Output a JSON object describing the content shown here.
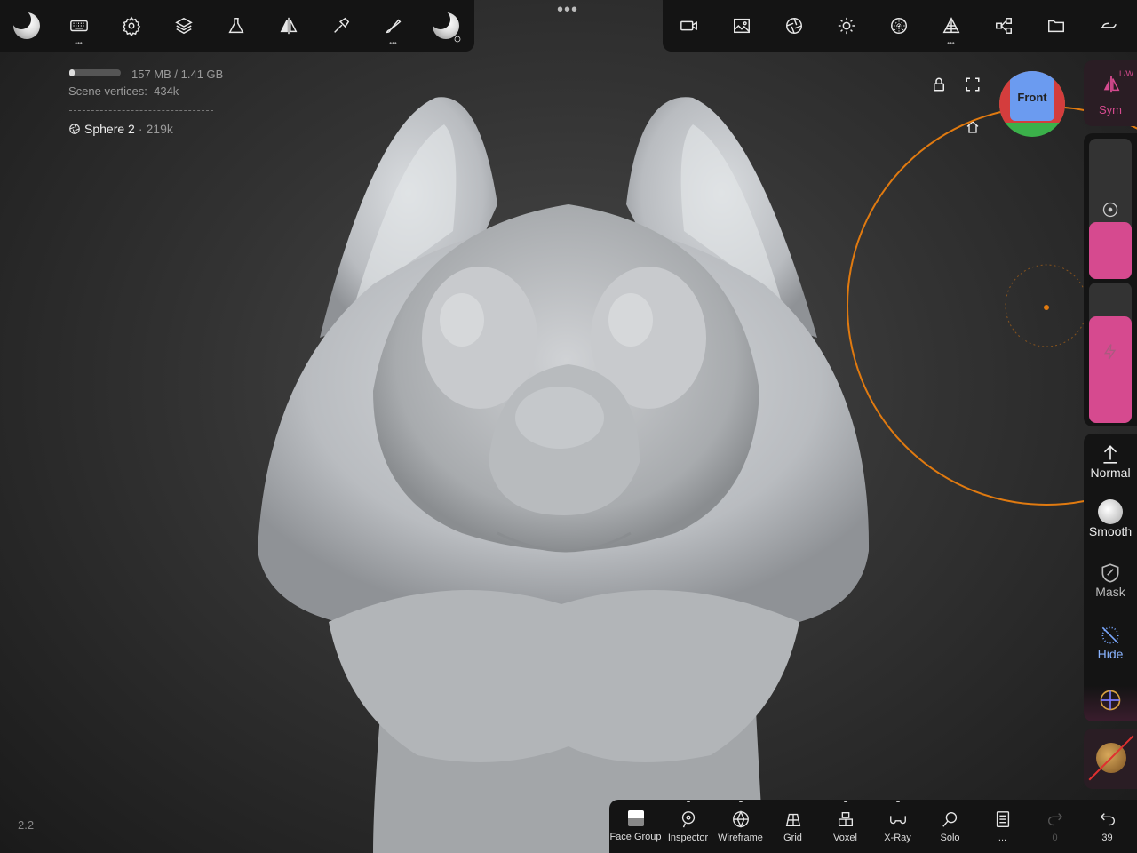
{
  "top_toolbar": {
    "left_tools": [
      "nomad-logo",
      "keyboard",
      "settings",
      "layers",
      "material",
      "symmetry",
      "brush",
      "paint",
      "stroke-settings"
    ],
    "right_tools": [
      "camera",
      "background",
      "shading",
      "lights",
      "matcap",
      "topology",
      "scene",
      "files",
      "quick-menu"
    ]
  },
  "stats": {
    "memory": "157 MB / 1.41 GB",
    "memory_fraction": 0.1,
    "vertices_label": "Scene vertices",
    "vertices_value": "434k",
    "object_name": "Sphere 2",
    "object_vertices": "219k"
  },
  "gizmo": {
    "face_label": "Front"
  },
  "right_panel": {
    "sym_corner": "L/W",
    "sym_label": "Sym",
    "normal_label": "Normal",
    "smooth_label": "Smooth",
    "mask_label": "Mask",
    "hide_label": "Hide"
  },
  "bottom_bar": {
    "items": [
      "Face Group",
      "Inspector",
      "Wireframe",
      "Grid",
      "Voxel",
      "X-Ray",
      "Solo",
      "...",
      "0",
      "39"
    ]
  },
  "zoom_label": "2.2",
  "colors": {
    "accent_pink": "#d64a8f",
    "brush_orange": "#e07a10",
    "toolbar_bg": "#141414"
  }
}
